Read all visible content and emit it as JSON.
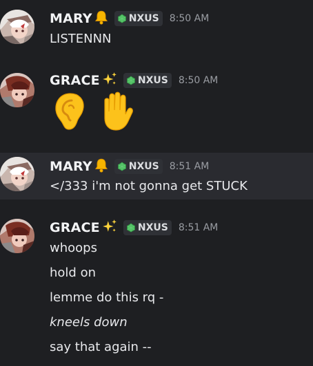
{
  "messages": [
    {
      "user": "MARY",
      "user_icon": "bell-icon",
      "tag": "NXUS",
      "time": "8:50 AM",
      "lines": [
        "LISTENNN"
      ]
    },
    {
      "user": "GRACE",
      "user_icon": "sparkles-icon",
      "tag": "NXUS",
      "time": "8:50 AM",
      "emojis": [
        "ear-emoji",
        "raised-hand-emoji"
      ]
    },
    {
      "user": "MARY",
      "user_icon": "bell-icon",
      "tag": "NXUS",
      "time": "8:51 AM",
      "lines": [
        "</333 i'm not gonna get STUCK"
      ]
    },
    {
      "user": "GRACE",
      "user_icon": "sparkles-icon",
      "tag": "NXUS",
      "time": "8:51 AM",
      "lines": [
        "whoops",
        "hold on",
        "lemme do this rq -",
        "kneels down",
        "say that again --"
      ]
    }
  ],
  "colors": {
    "background": "#1e1f22",
    "hover_row": "#2a2b30",
    "tag_bg": "#2f3136",
    "tag_gem": "#4fbf62",
    "timestamp": "#9a9da3",
    "text": "#e8e9ec"
  }
}
